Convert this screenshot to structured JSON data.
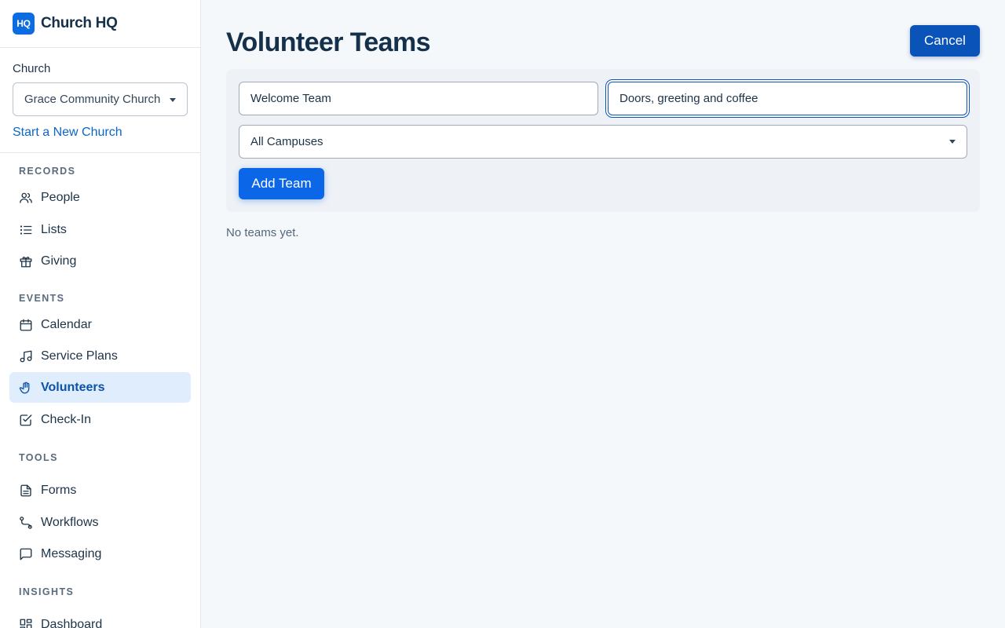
{
  "brand": {
    "logo_text": "HQ",
    "name": "Church HQ"
  },
  "church": {
    "label": "Church",
    "selected": "Grace Community Church",
    "new_link": "Start a New Church"
  },
  "nav": {
    "records": {
      "heading": "RECORDS",
      "items": [
        {
          "label": "People",
          "icon": "people-icon"
        },
        {
          "label": "Lists",
          "icon": "list-icon"
        },
        {
          "label": "Giving",
          "icon": "gift-icon"
        }
      ]
    },
    "events": {
      "heading": "EVENTS",
      "items": [
        {
          "label": "Calendar",
          "icon": "calendar-icon"
        },
        {
          "label": "Service Plans",
          "icon": "music-note-icon"
        },
        {
          "label": "Volunteers",
          "icon": "hand-icon",
          "active": true
        },
        {
          "label": "Check-In",
          "icon": "checkbox-icon"
        }
      ]
    },
    "tools": {
      "heading": "TOOLS",
      "items": [
        {
          "label": "Forms",
          "icon": "document-icon"
        },
        {
          "label": "Workflows",
          "icon": "workflow-icon"
        },
        {
          "label": "Messaging",
          "icon": "message-icon"
        }
      ]
    },
    "insights": {
      "heading": "INSIGHTS",
      "items": [
        {
          "label": "Dashboard",
          "icon": "dashboard-icon"
        }
      ]
    }
  },
  "page": {
    "title": "Volunteer Teams",
    "cancel_label": "Cancel",
    "form": {
      "team_name_value": "Welcome Team",
      "description_value": "Doors, greeting and coffee",
      "campus_selected": "All Campuses",
      "add_label": "Add Team"
    },
    "empty_message": "No teams yet."
  },
  "colors": {
    "accent": "#0b66e8",
    "accent_dark": "#0a53b8",
    "active_nav_bg": "#e0edfc",
    "page_bg": "#f5f8fb"
  }
}
